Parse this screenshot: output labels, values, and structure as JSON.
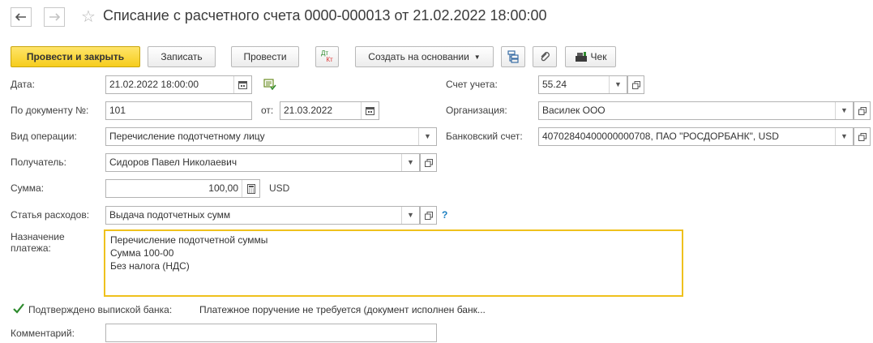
{
  "window": {
    "title": "Списание с расчетного счета 0000-000013 от 21.02.2022 18:00:00"
  },
  "nav": {
    "back_icon": "arrow-left-icon",
    "forward_icon": "arrow-right-icon",
    "favorite_icon": "star-icon"
  },
  "toolbar": {
    "post_and_close": "Провести и закрыть",
    "save": "Записать",
    "post": "Провести",
    "dt_kt_top": "Дт",
    "dt_kt_bottom": "Кт",
    "create_based_on": "Создать на основании",
    "receipt": "Чек"
  },
  "form": {
    "date_label": "Дата:",
    "date_value": "21.02.2022 18:00:00",
    "doc_num_label": "По документу №:",
    "doc_num_value": "101",
    "from_label": "от:",
    "from_value": "21.03.2022",
    "operation_label": "Вид операции:",
    "operation_value": "Перечисление подотчетному лицу",
    "recipient_label": "Получатель:",
    "recipient_value": "Сидоров Павел Николаевич",
    "amount_label": "Сумма:",
    "amount_value": "100,00",
    "currency": "USD",
    "expense_label": "Статья расходов:",
    "expense_value": "Выдача подотчетных сумм",
    "help": "?",
    "purpose_label_1": "Назначение",
    "purpose_label_2": "платежа:",
    "purpose_lines": [
      "Перечисление подотчетной суммы",
      "Сумма 100-00",
      "Без налога (НДС)"
    ],
    "account_label": "Счет учета:",
    "account_value": "55.24",
    "org_label": "Организация:",
    "org_value": "Василек ООО",
    "bank_label": "Банковский счет:",
    "bank_value": "40702840400000000708, ПАО \"РОСДОРБАНК\", USD",
    "confirmed_label": "Подтверждено выпиской банка:",
    "payment_order_text": "Платежное поручение не требуется (документ исполнен банк...",
    "comment_label": "Комментарий:",
    "comment_value": ""
  },
  "colors": {
    "primary_button": "#f6cd1c",
    "focus_border": "#efc11d",
    "help_link": "#1a7fc1",
    "check_green": "#2e8b2e"
  }
}
